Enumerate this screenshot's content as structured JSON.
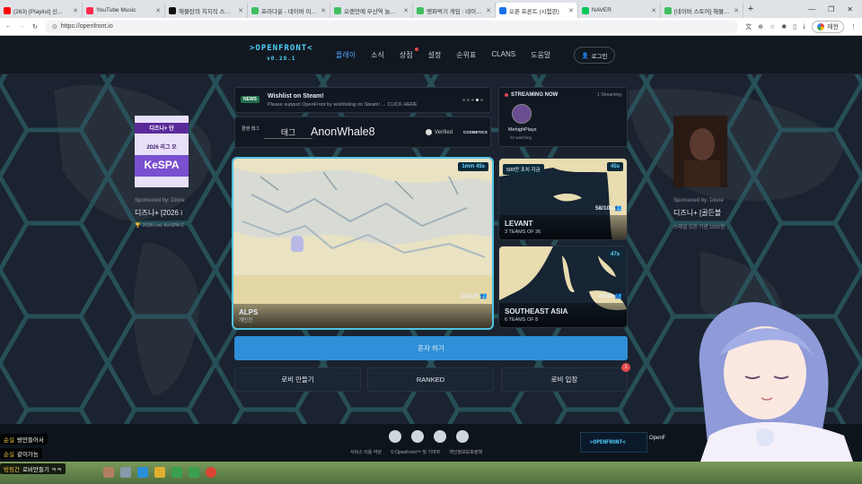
{
  "browser": {
    "tabs": [
      {
        "title": "(263) [Playlist] 신...",
        "color": "#ff0000"
      },
      {
        "title": "YouTube Music",
        "color": "#ff2a4a"
      },
      {
        "title": "해물탄의 치지직 스튜디...",
        "color": "#111111"
      },
      {
        "title": "프라다운 - 네이버 이미...",
        "color": "#3fbf5f"
      },
      {
        "title": "오랜만에 부산역 놀라도...",
        "color": "#3fbf5f"
      },
      {
        "title": "땡파먹기 게임 : 네이버...",
        "color": "#3fbf5f"
      },
      {
        "title": "오픈 프론트 (시험판)",
        "color": "#1a73e8",
        "active": true
      },
      {
        "title": "NAVER",
        "color": "#03c75a"
      },
      {
        "title": "[네이버 스토어] 해물탄...",
        "color": "#3fbf5f"
      }
    ],
    "url": "https://openfront.io",
    "profile_label": "재현"
  },
  "nav": {
    "logo": ">OPENFRONT<",
    "version": "v0.28.1",
    "items": [
      "플레이",
      "소식",
      "상점",
      "설정",
      "순위표",
      "CLANS",
      "도움말"
    ],
    "login": "로그인"
  },
  "ads": {
    "left": {
      "sponsor": "Sponsored by: Disne",
      "title": "디즈니+ [2026 i",
      "sub": "🏆 2026 LoL KeSPA C",
      "img_text": "KeSPA",
      "img_header": "디즈니+ 단",
      "img_line": "2026 리그 오"
    },
    "right": {
      "sponsor": "Sponsored by: Disne",
      "title": "디즈니+ [골든볼",
      "sub": "스페셜 오픈 기념 1500원"
    }
  },
  "news": {
    "badge": "NEWS",
    "title": "Wishlist on Steam!",
    "text": "Please support OpenFront by wishlisting on Steam! → CLICK HERE"
  },
  "streaming": {
    "header": "STREAMING NOW",
    "count": "1 Streaming",
    "streamer": "MehighPlays",
    "watching": "32 watching"
  },
  "player": {
    "tag_label": "클랜 태그",
    "tag_value": "태그",
    "name": "AnonWhale8",
    "verified": "Verified",
    "cosmetics": "COSMETICS"
  },
  "lobbies": {
    "main": {
      "name": "ALPS",
      "mode": "개인전",
      "time": "1min 45s",
      "players": "12/125"
    },
    "levant": {
      "name": "LEVANT",
      "mode": "3 TEAMS OF 36",
      "time": "45s",
      "players": "58/108",
      "badge": "500만 조치 지금"
    },
    "sea": {
      "name": "SOUTHEAST ASIA",
      "mode": "6 TEAMS OF 8",
      "time": "47s",
      "players": "29/48"
    }
  },
  "actions": {
    "solo": "혼자 하기",
    "create": "로비 만들기",
    "ranked": "RANKED",
    "join": "로비 입장",
    "join_badge": "1"
  },
  "footer": {
    "links": [
      "서비스 이용 약관",
      "© OpenFront™ 및 기여자",
      "개인정보보호정책"
    ],
    "icons": [
      "github-icon",
      "reddit-icon",
      "discord-icon",
      "globe-icon"
    ],
    "ad_logo": ">OPENFRONT<",
    "ad_side": "OpenF"
  },
  "overlays": {
    "chat": [
      {
        "user": "순실",
        "msg": "방만들어서"
      },
      {
        "user": "순실",
        "msg": "같이가능"
      },
      {
        "user": "빙핑간",
        "msg": "로비만들기 ㅋㅋ"
      }
    ]
  },
  "colors": {
    "accent": "#4fc3e0",
    "primary_button": "#2f8fd8",
    "nav_active": "#4fa8ff"
  }
}
